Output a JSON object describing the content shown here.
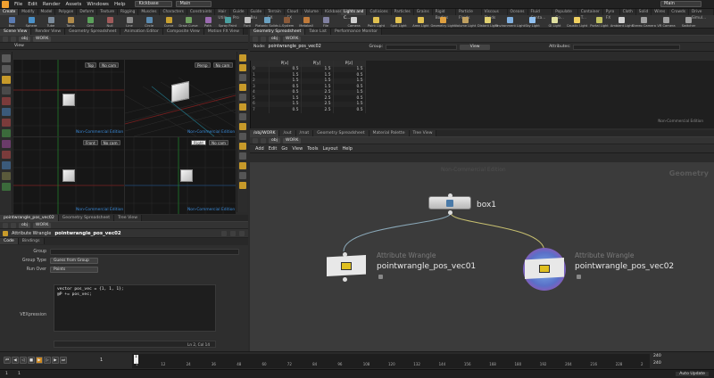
{
  "menubar": {
    "items": [
      "File",
      "Edit",
      "Render",
      "Assets",
      "Windows",
      "Help"
    ],
    "desktop": "Kickbase",
    "context": "Main",
    "right_context": "Main"
  },
  "shelf": {
    "left_tabs": [
      "Create",
      "Modify",
      "Model",
      "Polygon",
      "Deform",
      "Texture",
      "Rigging",
      "Muscles",
      "Characters",
      "Constraints",
      "Hair Utils",
      "Guide Pro",
      "Guide Bru",
      "Terrain FX",
      "Cloud FX",
      "Volume",
      "Kickbase"
    ],
    "left_tools": [
      "Box",
      "Sphere",
      "Tube",
      "Torus",
      "Grid",
      "Null",
      "Line",
      "Circle",
      "Curve",
      "Draw Curve",
      "Path",
      "Spray Paint",
      "Font",
      "Platonic Solids",
      "L-System",
      "Metaball",
      "File"
    ],
    "right_tabs": [
      "Lights and C...",
      "Collisions",
      "Particles",
      "Grains",
      "Rigid Bodies",
      "Particle Fluids",
      "Viscous Fluids",
      "Oceans",
      "Fluid Conta...",
      "Populate Co...",
      "Container T...",
      "Pyro FX",
      "Cloth",
      "Solid",
      "Wires",
      "Crowds",
      "Drive Simul..."
    ],
    "right_tools": [
      "Camera",
      "Point Light",
      "Spot Light",
      "Area Light",
      "Geometry Light",
      "Volume Light",
      "Distant Light",
      "Environment Light",
      "Sky Light",
      "GI Light",
      "Caustic Light",
      "Portal Light",
      "Ambient Light",
      "Stereo Camera",
      "VR Camera",
      "Switcher"
    ]
  },
  "left_pane": {
    "tabs": [
      "Scene View",
      "Render View",
      "Geometry Spreadsheet",
      "Animation Editor",
      "Composite View",
      "Motion FX View"
    ],
    "path": [
      "obj",
      "WORK"
    ],
    "view_label": "View"
  },
  "viewports": [
    {
      "camera": "Top",
      "cam": "No cam",
      "watermark": "Non-Commercial Edition"
    },
    {
      "camera": "Persp",
      "cam": "No cam",
      "watermark": "Non-Commercial Edition"
    },
    {
      "camera": "Front",
      "cam": "No cam",
      "watermark": "Non-Commercial Edition"
    },
    {
      "camera": "Right",
      "cam": "No cam",
      "watermark": "Non-Commercial Edition"
    }
  ],
  "param_pane": {
    "tabs": [
      "pointwrangle_pos_vec02",
      "Geometry Spreadsheet",
      "Tree View"
    ],
    "path": [
      "obj",
      "WORK"
    ],
    "node_type": "Attribute Wrangle",
    "node_name": "pointwrangle_pos_vec02",
    "subtabs": [
      "Code",
      "Bindings"
    ],
    "group_label": "Group",
    "group_value": "",
    "group_type_label": "Group Type",
    "group_type_value": "Guess from Group",
    "run_over_label": "Run Over",
    "run_over_value": "Points",
    "vex_label": "VEXpression",
    "code": [
      "vector pos_vec = {1, 1, 1};",
      "@P += pos_vec;"
    ],
    "cursor": "Ln 2, Col 14"
  },
  "spreadsheet": {
    "tabs": [
      "Geometry Spreadsheet",
      "Take List",
      "Performance Monitor"
    ],
    "path": [
      "obj",
      "WORK"
    ],
    "node_label": "Node:",
    "node_value": "pointwrangle_pos_vec02",
    "group_label": "Group:",
    "view_label": "View",
    "attributes_label": "Attributes:",
    "columns": [
      "",
      "P[x]",
      "P[y]",
      "P[z]"
    ],
    "rows": [
      [
        "0",
        "0.5",
        "1.5",
        "1.5"
      ],
      [
        "1",
        "1.5",
        "1.5",
        "0.5"
      ],
      [
        "2",
        "1.5",
        "1.5",
        "1.5"
      ],
      [
        "3",
        "0.5",
        "1.5",
        "0.5"
      ],
      [
        "4",
        "0.5",
        "2.5",
        "1.5"
      ],
      [
        "5",
        "1.5",
        "2.5",
        "0.5"
      ],
      [
        "6",
        "1.5",
        "2.5",
        "1.5"
      ],
      [
        "7",
        "0.5",
        "2.5",
        "0.5"
      ]
    ],
    "watermark": "Non-Commercial Edition"
  },
  "network": {
    "tabs": [
      "/obj/WORK",
      "/out",
      "/mat",
      "Geometry Spreadsheet",
      "Material Palette",
      "Tree View"
    ],
    "path": [
      "obj",
      "WORK"
    ],
    "menu": [
      "Add",
      "Edit",
      "Go",
      "View",
      "Tools",
      "Layout",
      "Help"
    ],
    "watermark": "Non-Commercial Edition",
    "context_label": "Geometry",
    "nodes": [
      {
        "type": "",
        "name": "box1"
      },
      {
        "type": "Attribute Wrangle",
        "name": "pointwrangle_pos_vec01"
      },
      {
        "type": "Attribute Wrangle",
        "name": "pointwrangle_pos_vec02"
      }
    ]
  },
  "timeline": {
    "frame": "1",
    "start": "1",
    "start2": "1",
    "end": "240",
    "end2": "240",
    "ticks": [
      "1",
      "12",
      "24",
      "36",
      "48",
      "60",
      "72",
      "84",
      "96",
      "108",
      "120",
      "132",
      "144",
      "156",
      "168",
      "180",
      "192",
      "204",
      "216",
      "228",
      "2"
    ]
  },
  "status": {
    "auto_update": "Auto Update"
  }
}
